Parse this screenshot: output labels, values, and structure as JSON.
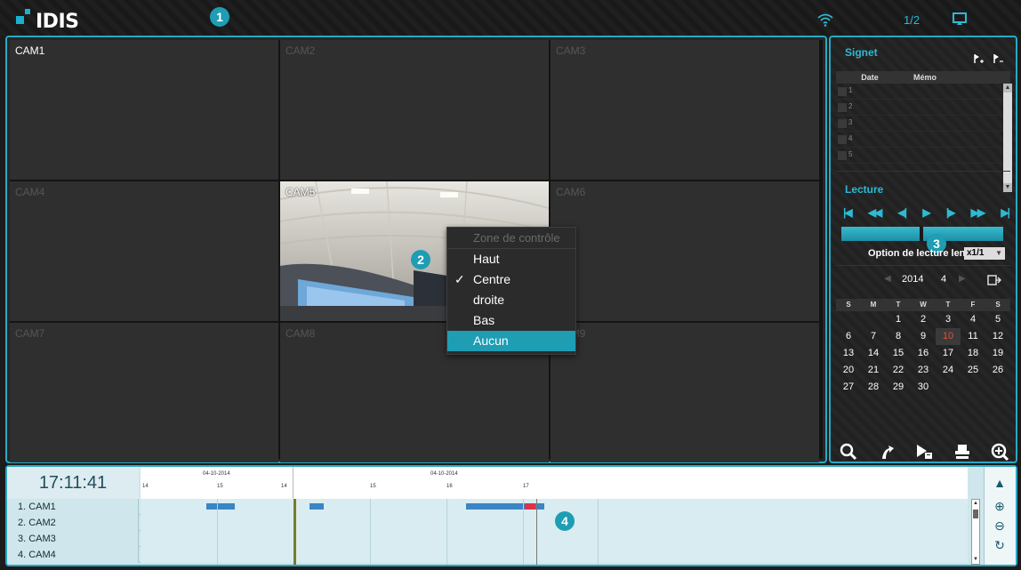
{
  "app": {
    "logo_text": "IDIS",
    "page_indicator": "1/2"
  },
  "callouts": [
    "1",
    "2",
    "3",
    "4"
  ],
  "cameras": [
    "CAM1",
    "CAM2",
    "CAM3",
    "CAM4",
    "CAM5",
    "CAM6",
    "CAM7",
    "CAM8",
    "CAM9"
  ],
  "context_menu": {
    "header": "Zone de contrôle",
    "items": [
      {
        "label": "Haut",
        "checked": false
      },
      {
        "label": "Centre",
        "checked": true
      },
      {
        "label": "droite",
        "checked": false
      },
      {
        "label": "Bas",
        "checked": false
      },
      {
        "label": "Aucun",
        "checked": false,
        "highlighted": true
      }
    ],
    "check_glyph": "✓"
  },
  "bookmark": {
    "title": "Signet",
    "col_date": "Date",
    "col_memo": "Mémo",
    "rows": [
      "1",
      "2",
      "3",
      "4",
      "5"
    ]
  },
  "playback": {
    "title": "Lecture",
    "slow_label": "Option de lecture lente",
    "slow_value": "x1/1"
  },
  "calendar": {
    "year": "2014",
    "month": "4",
    "weekdays": [
      "S",
      "M",
      "T",
      "W",
      "T",
      "F",
      "S"
    ],
    "days": [
      "",
      "",
      "1",
      "2",
      "3",
      "4",
      "5",
      "6",
      "7",
      "8",
      "9",
      "10",
      "11",
      "12",
      "13",
      "14",
      "15",
      "16",
      "17",
      "18",
      "19",
      "20",
      "21",
      "22",
      "23",
      "24",
      "25",
      "26",
      "27",
      "28",
      "29",
      "30",
      "",
      "",
      ""
    ],
    "today": "10"
  },
  "timeline": {
    "current_time": "17:11:41",
    "date_labels": [
      "04-10-2014",
      "04-10-2014"
    ],
    "hour_labels": [
      "14",
      "15",
      "14",
      "15",
      "16",
      "17"
    ],
    "rows": [
      "1. CAM1",
      "2. CAM2",
      "3. CAM3",
      "4. CAM4"
    ],
    "colors": {
      "record": "#3a86c4",
      "event": "#e0304a",
      "accent": "#27a9c4"
    }
  }
}
